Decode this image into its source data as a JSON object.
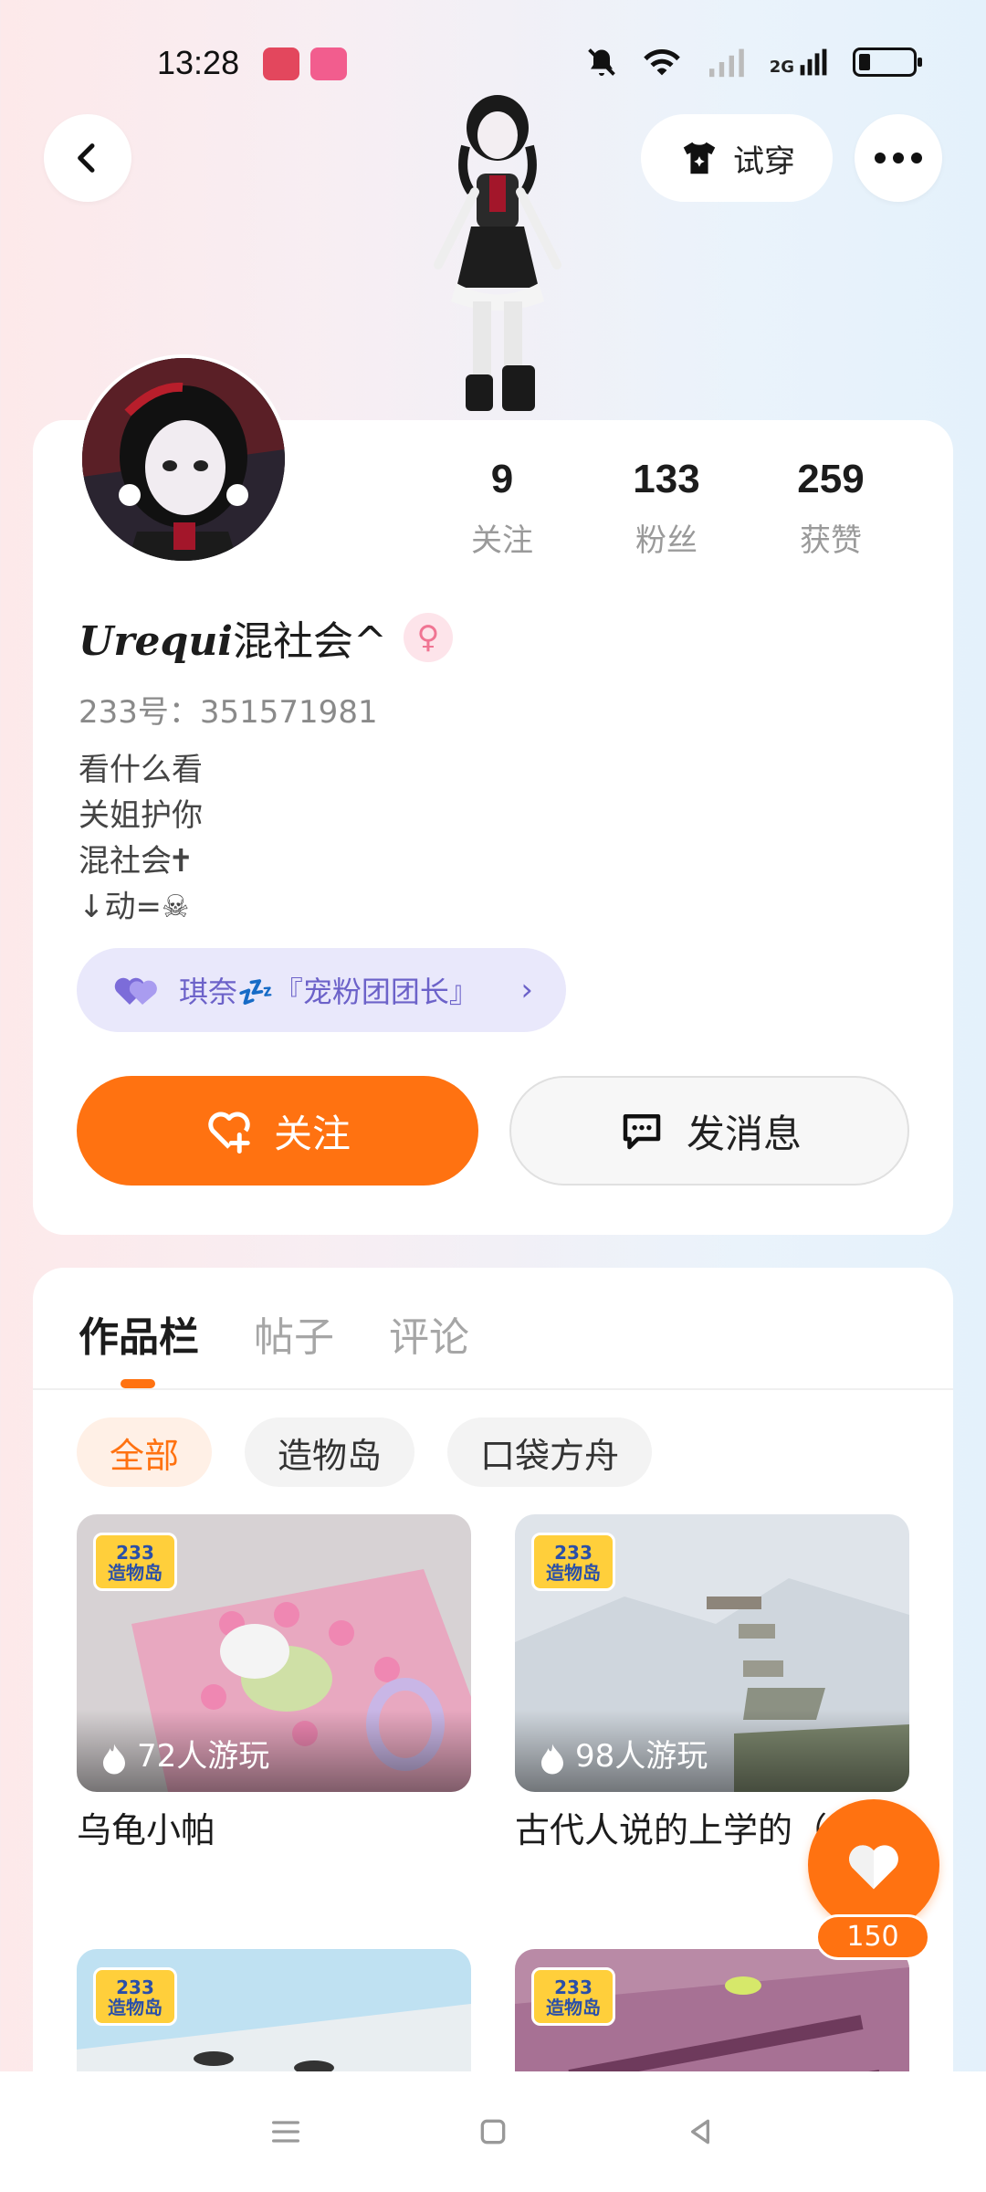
{
  "status_bar": {
    "time": "13:28",
    "app_icons": [
      "kuaishou-icon",
      "bilibili-icon"
    ],
    "network_label": "2G",
    "indicators": [
      "mute-icon",
      "wifi-icon",
      "signal-icon",
      "battery-icon"
    ]
  },
  "header": {
    "back_icon": "chevron-left-icon",
    "tryon_label": "试穿",
    "more_icon": "more-dots-icon"
  },
  "profile": {
    "stats": [
      {
        "value": "9",
        "label": "关注"
      },
      {
        "value": "133",
        "label": "粉丝"
      },
      {
        "value": "259",
        "label": "获赞"
      }
    ],
    "name_script": "Urequi",
    "name_text": "混社会^",
    "gender": "female",
    "uid": "233号：351571981",
    "bio": [
      "看什么看",
      "关姐护你",
      "混社会🕇",
      "↓动=☠"
    ],
    "fan_group": "琪奈💤『宠粉团团长』",
    "follow_label": "关注",
    "message_label": "发消息"
  },
  "works": {
    "tabs": [
      "作品栏",
      "帖子",
      "评论"
    ],
    "active_tab": 0,
    "filters": [
      "全部",
      "造物岛",
      "口袋方舟"
    ],
    "active_filter": 0,
    "badge_text": [
      "233",
      "造物岛"
    ],
    "items": [
      {
        "title": "乌龟小帕",
        "plays": "72人游玩"
      },
      {
        "title": "古代人说的上学的（上）",
        "plays": "98人游玩"
      },
      {
        "title": "",
        "plays": ""
      },
      {
        "title": "",
        "plays": ""
      }
    ]
  },
  "like_fab": {
    "count": "150"
  },
  "colors": {
    "accent": "#ff7211",
    "fan_pill": "#e9e8fb",
    "fan_text": "#6c62c9"
  }
}
